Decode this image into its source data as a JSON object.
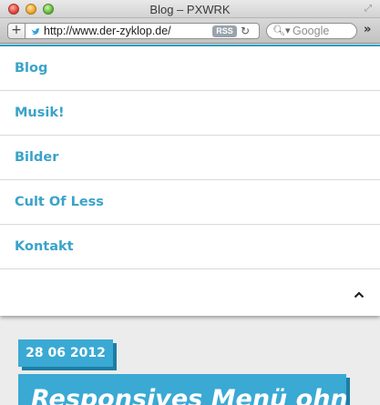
{
  "window": {
    "title": "Blog – PXWRK"
  },
  "toolbar": {
    "add_label": "+",
    "url": "http://www.der-zyklop.de/",
    "rss_label": "RSS",
    "search_placeholder": "Google"
  },
  "icons": {
    "close": "close-window-icon",
    "minimize": "minimize-window-icon",
    "maximize": "maximize-window-icon",
    "resize": "fullscreen-icon",
    "favicon": "twitter-bird-icon",
    "reload": "reload-icon",
    "search": "magnifier-icon",
    "overflow": "chevron-double-right-icon",
    "collapse": "chevron-up-icon"
  },
  "nav": {
    "items": [
      {
        "label": "Blog"
      },
      {
        "label": "Musik!"
      },
      {
        "label": "Bilder"
      },
      {
        "label": "Cult Of Less"
      },
      {
        "label": "Kontakt"
      }
    ]
  },
  "post": {
    "date": "28 06 2012",
    "title": "Responsives Menü ohne"
  },
  "colors": {
    "accent": "#3aa3c8",
    "badge": "#3aa9d4",
    "badge_shadow": "#1d7ea3"
  }
}
